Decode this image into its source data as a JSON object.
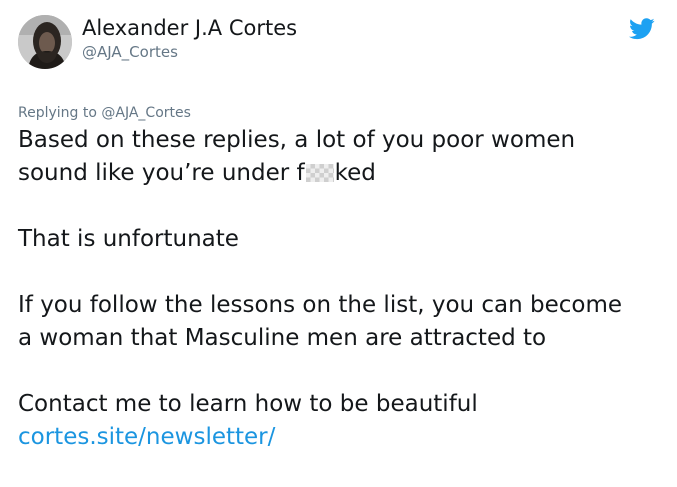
{
  "author": {
    "display_name": "Alexander J.A Cortes",
    "handle": "@AJA_Cortes"
  },
  "brand_icon": "twitter-bird-icon",
  "colors": {
    "text": "#14171a",
    "muted": "#657786",
    "accent": "#1da1f2",
    "link": "#1b95e0"
  },
  "reply": {
    "prefix": "Replying to",
    "mention": "@AJA_Cortes"
  },
  "tweet": {
    "para1_line1": "Based on these replies, a lot of you poor women",
    "para1_line2_start": "sound like you’re under f",
    "para1_line2_end": "ked",
    "para2": "That is unfortunate",
    "para3_line1": "If you follow the lessons on the list, you can become",
    "para3_line2": "a woman that Masculine men are attracted to",
    "para4_line1": "Contact me to learn how to be beautiful",
    "link": "cortes.site/newsletter/"
  }
}
